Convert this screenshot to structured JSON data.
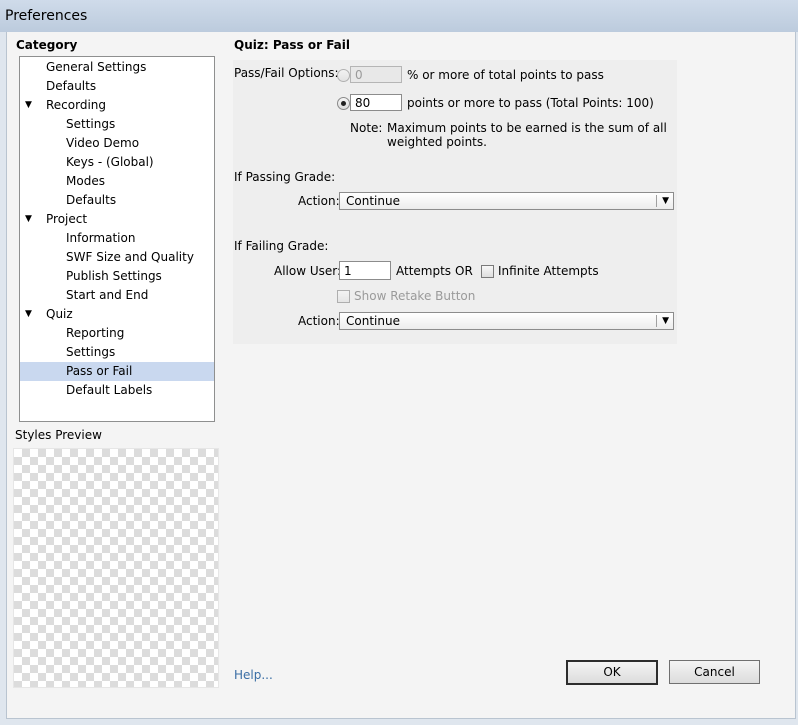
{
  "window": {
    "title": "Preferences"
  },
  "sidebar": {
    "heading": "Category",
    "items": [
      {
        "label": "General Settings",
        "level": 0,
        "expander": ""
      },
      {
        "label": "Defaults",
        "level": 0,
        "expander": ""
      },
      {
        "label": "Recording",
        "level": 0,
        "expander": "▼"
      },
      {
        "label": "Settings",
        "level": 1,
        "expander": ""
      },
      {
        "label": "Video Demo",
        "level": 1,
        "expander": ""
      },
      {
        "label": "Keys - (Global)",
        "level": 1,
        "expander": ""
      },
      {
        "label": "Modes",
        "level": 1,
        "expander": ""
      },
      {
        "label": "Defaults",
        "level": 1,
        "expander": ""
      },
      {
        "label": "Project",
        "level": 0,
        "expander": "▼"
      },
      {
        "label": "Information",
        "level": 1,
        "expander": ""
      },
      {
        "label": "SWF Size and Quality",
        "level": 1,
        "expander": ""
      },
      {
        "label": "Publish Settings",
        "level": 1,
        "expander": ""
      },
      {
        "label": "Start and End",
        "level": 1,
        "expander": ""
      },
      {
        "label": "Quiz",
        "level": 0,
        "expander": "▼"
      },
      {
        "label": "Reporting",
        "level": 1,
        "expander": ""
      },
      {
        "label": "Settings",
        "level": 1,
        "expander": ""
      },
      {
        "label": "Pass or Fail",
        "level": 1,
        "expander": "",
        "selected": true
      },
      {
        "label": "Default Labels",
        "level": 1,
        "expander": ""
      }
    ],
    "styles_preview_label": "Styles Preview"
  },
  "main": {
    "section_title": "Quiz: Pass or Fail",
    "pass_fail_options_label": "Pass/Fail Options:",
    "percent_option": {
      "value": "0",
      "suffix": "% or more of total points to pass",
      "selected": false
    },
    "points_option": {
      "value": "80",
      "suffix": "points or more to pass (Total Points: 100)",
      "selected": true
    },
    "note_label": "Note:",
    "note_line1": "Maximum points to be earned is the sum of all",
    "note_line2": "weighted points.",
    "passing": {
      "heading": "If Passing Grade:",
      "action_label": "Action:",
      "action_value": "Continue"
    },
    "failing": {
      "heading": "If Failing Grade:",
      "allow_user_label": "Allow User:",
      "attempts_value": "1",
      "attempts_label": "Attempts",
      "or_label": "OR",
      "infinite_attempts_label": "Infinite Attempts",
      "infinite_attempts_checked": false,
      "show_retake_label": "Show Retake Button",
      "show_retake_checked": false,
      "action_label": "Action:",
      "action_value": "Continue"
    }
  },
  "footer": {
    "help_link": "Help...",
    "ok_label": "OK",
    "cancel_label": "Cancel"
  },
  "colors": {
    "selection": "#c9d8ef",
    "link": "#3a6ea5",
    "titlebar": "#c6d4e5"
  }
}
